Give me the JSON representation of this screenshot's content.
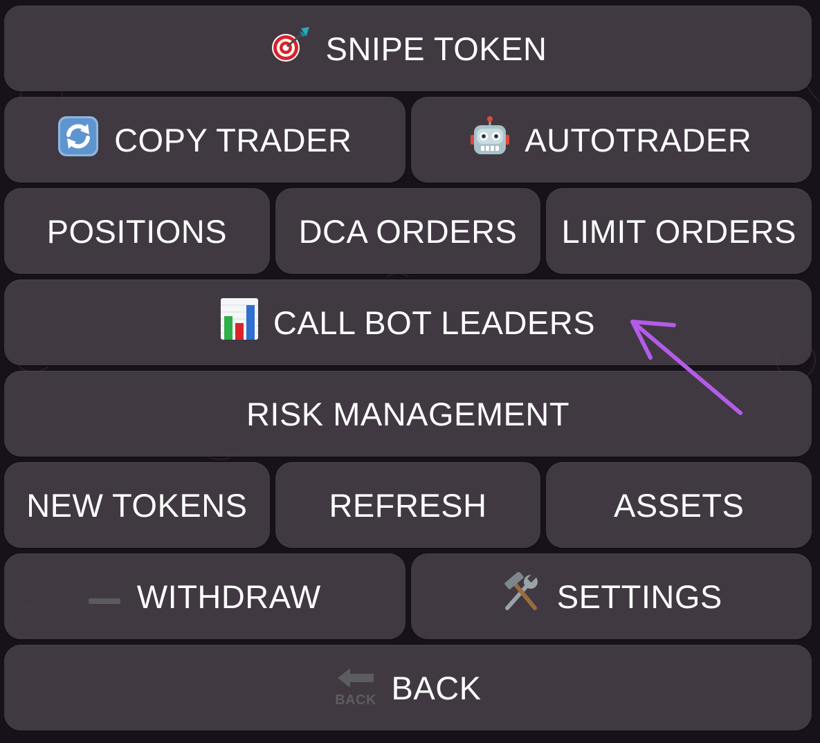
{
  "buttons": {
    "snipe_token": "SNIPE TOKEN",
    "copy_trader": "COPY TRADER",
    "autotrader": "AUTOTRADER",
    "positions": "POSITIONS",
    "dca_orders": "DCA ORDERS",
    "limit_orders": "LIMIT ORDERS",
    "call_bot_leaders": "CALL BOT LEADERS",
    "risk_management": "RISK MANAGEMENT",
    "new_tokens": "NEW TOKENS",
    "refresh": "REFRESH",
    "assets": "ASSETS",
    "withdraw": "WITHDRAW",
    "settings": "SETTINGS",
    "back": "BACK"
  },
  "icons": {
    "snipe_token": "dart-target-icon",
    "copy_trader": "refresh-arrows-icon",
    "autotrader": "robot-icon",
    "call_bot_leaders": "bar-chart-icon",
    "withdraw": "minus-icon",
    "settings": "hammer-wrench-icon",
    "back": "back-arrow-icon",
    "back_icon_text": "BACK"
  },
  "colors": {
    "button_bg": "#443c46",
    "background": "#17121a",
    "text": "#ffffff",
    "annotation_arrow": "#b25ce8"
  }
}
